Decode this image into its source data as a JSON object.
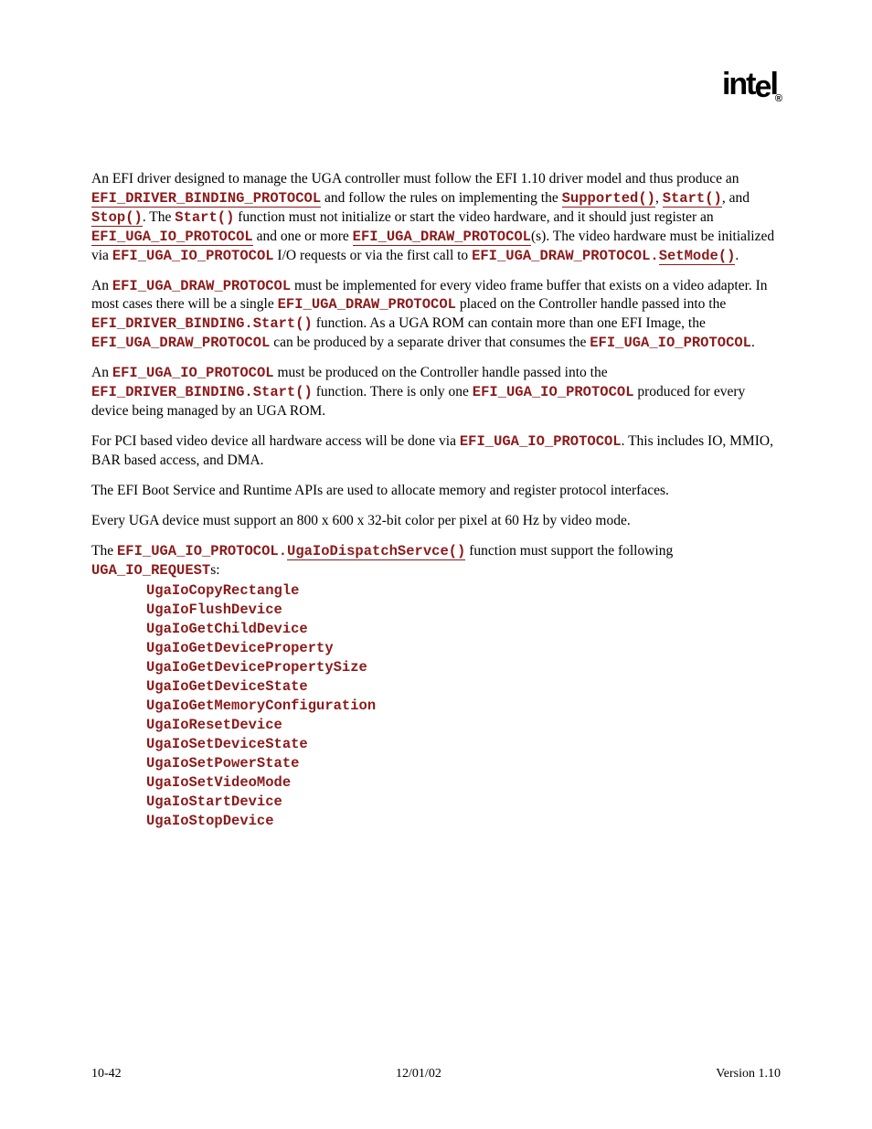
{
  "logo": "intel",
  "para1": {
    "t1": "An EFI driver designed to manage the UGA controller must follow the EFI 1.10 driver model and thus produce an ",
    "c1": "EFI_DRIVER_BINDING_PROTOCOL",
    "t2": " and follow the rules on implementing the ",
    "c2": "Supported()",
    "t3": ", ",
    "c3": "Start()",
    "t4": ", and ",
    "c4": "Stop()",
    "t5": ".  The ",
    "c5": "Start()",
    "t6": " function must not initialize or start the video hardware, and it should just register an ",
    "c6": "EFI_UGA_IO_PROTOCOL",
    "t7": " and one or more ",
    "c7": "EFI_UGA_DRAW_PROTOCOL",
    "t8": "(s).  The video hardware must be initialized via ",
    "c8": "EFI_UGA_IO_PROTOCOL",
    "t9": " I/O requests or via the first call to ",
    "c9": "EFI_UGA_DRAW_PROTOCOL.",
    "c10": "SetMode()",
    "t10": "."
  },
  "para2": {
    "t1": "An ",
    "c1": "EFI_UGA_DRAW_PROTOCOL",
    "t2": " must be implemented for every video frame buffer that exists on a video adapter.  In most cases there will be a single ",
    "c2": "EFI_UGA_DRAW_PROTOCOL",
    "t3": " placed on the Controller handle passed into the ",
    "c3": "EFI_DRIVER_BINDING.Start()",
    "t4": " function.  As a UGA ROM can contain more than one EFI Image, the  ",
    "c4": "EFI_UGA_DRAW_PROTOCOL",
    "t5": " can be produced by a separate driver that consumes the ",
    "c5": "EFI_UGA_IO_PROTOCOL",
    "t6": "."
  },
  "para3": {
    "t1": "An ",
    "c1": "EFI_UGA_IO_PROTOCOL",
    "t2": " must be produced on the Controller handle passed into the ",
    "c2": "EFI_DRIVER_BINDING.Start()",
    "t3": " function.  There is only one ",
    "c3": "EFI_UGA_IO_PROTOCOL",
    "t4": " produced for every device being managed by an UGA ROM."
  },
  "para4": {
    "t1": "For PCI based video device all hardware access will be done via ",
    "c1": "EFI_UGA_IO_PROTOCOL",
    "t2": ".  This includes IO, MMIO, BAR based access, and DMA."
  },
  "para5": "The EFI Boot Service and Runtime APIs are used to allocate memory and register protocol interfaces.",
  "para6": "Every UGA device must support an 800 x 600 x 32-bit color per pixel at 60 Hz by video mode.",
  "para7": {
    "t1": "The ",
    "c1": "EFI_UGA_IO_PROTOCOL.",
    "c2": "UgaIoDispatchServce()",
    "t2": " function must support the following ",
    "c3": "UGA_IO_REQUEST",
    "t3": "s:"
  },
  "reqs": [
    "UgaIoCopyRectangle",
    "UgaIoFlushDevice",
    "UgaIoGetChildDevice",
    "UgaIoGetDeviceProperty",
    "UgaIoGetDevicePropertySize",
    "UgaIoGetDeviceState",
    "UgaIoGetMemoryConfiguration",
    "UgaIoResetDevice",
    "UgaIoSetDeviceState",
    "UgaIoSetPowerState",
    "UgaIoSetVideoMode",
    "UgaIoStartDevice",
    "UgaIoStopDevice"
  ],
  "footer": {
    "left": "10-42",
    "center": "12/01/02",
    "right": "Version 1.10"
  }
}
